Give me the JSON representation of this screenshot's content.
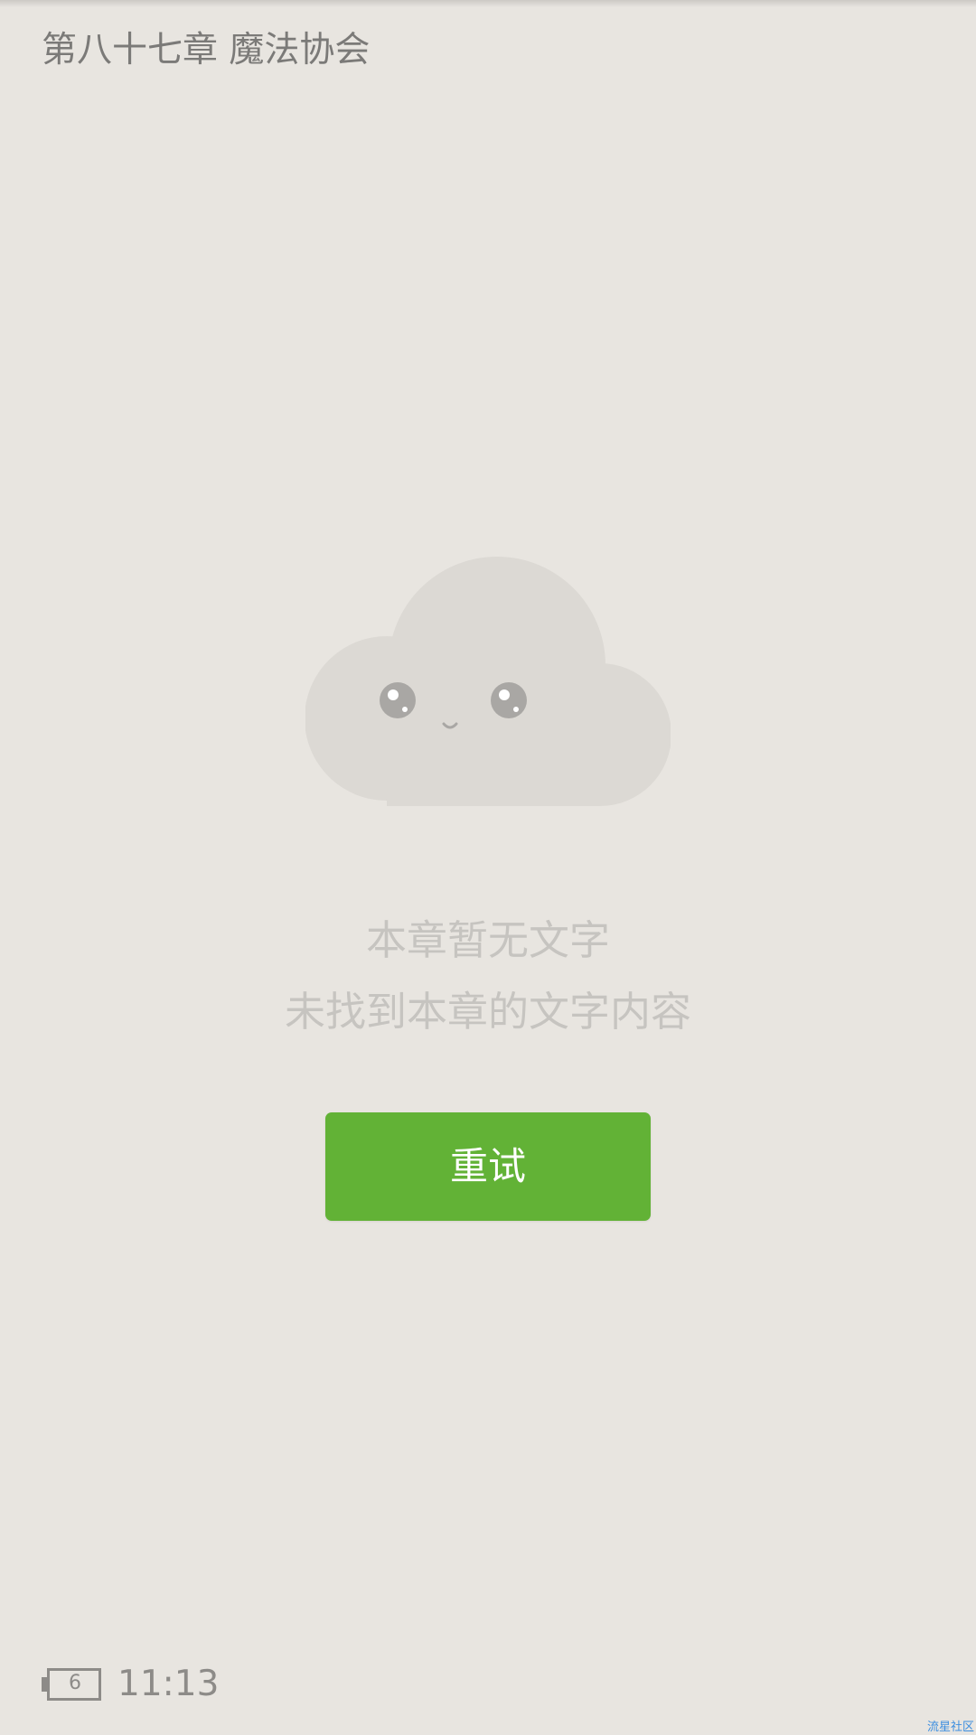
{
  "header": {
    "chapter_title": "第八十七章 魔法协会"
  },
  "empty_state": {
    "illustration_icon": "smiling-cloud-icon",
    "line1": "本章暂无文字",
    "line2": "未找到本章的文字内容",
    "retry_label": "重试"
  },
  "status_bar": {
    "battery_icon": "battery-icon",
    "battery_level": "6",
    "time": "11:13"
  },
  "watermark": {
    "text": "流星社区"
  },
  "colors": {
    "background": "#e8e5e0",
    "accent_button": "#62b236",
    "title_text": "#7b7a78",
    "message_text": "#c6c4c0"
  }
}
